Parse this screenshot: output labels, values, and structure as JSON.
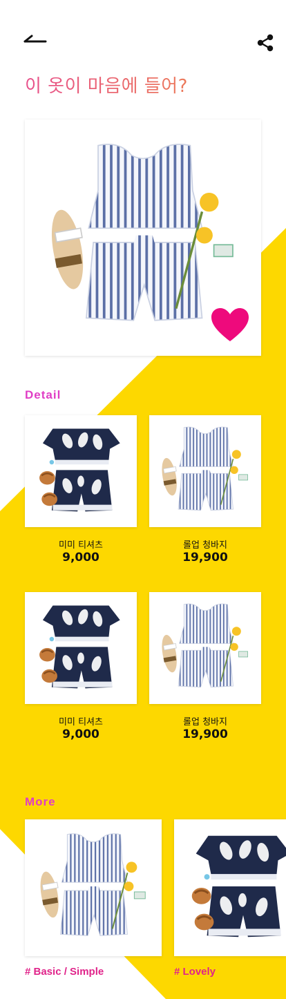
{
  "header": {
    "back_icon": "back-arrow-icon",
    "share_icon": "share-icon",
    "title": "이 옷이 마음에 들어?"
  },
  "hero": {
    "product_image": "striped-two-piece-set",
    "like_icon": "heart-icon",
    "like_color": "#ee0a7c"
  },
  "detail": {
    "label": "Detail",
    "items": [
      {
        "name": "미미 티셔츠",
        "price": "9,000",
        "image": "navy-leaf-print-set"
      },
      {
        "name": "롤업 청바지",
        "price": "19,900",
        "image": "striped-two-piece-set"
      },
      {
        "name": "미미 티셔츠",
        "price": "9,000",
        "image": "navy-leaf-print-set"
      },
      {
        "name": "롤업 청바지",
        "price": "19,900",
        "image": "striped-two-piece-set"
      }
    ]
  },
  "more": {
    "label": "More",
    "items": [
      {
        "tag": "# Basic / Simple",
        "image": "striped-two-piece-set"
      },
      {
        "tag": "# Lovely",
        "image": "navy-leaf-print-set"
      }
    ]
  },
  "colors": {
    "accent_yellow": "#fdd800",
    "label_magenta": "#e03dc5",
    "tag_pink": "#e0248a",
    "title_gradient_start": "#e8508c",
    "title_gradient_end": "#ec7a5a"
  }
}
